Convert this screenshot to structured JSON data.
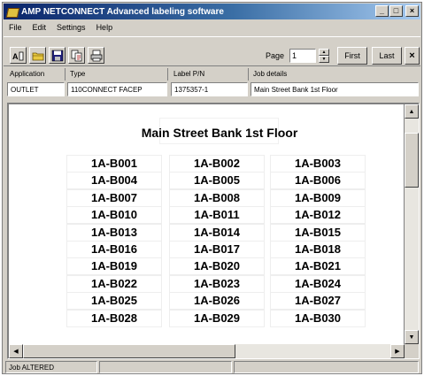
{
  "window": {
    "title": "AMP NETCONNECT Advanced labeling software",
    "minimize": "_",
    "maximize": "□",
    "close": "×"
  },
  "menu": [
    "File",
    "Edit",
    "Settings",
    "Help"
  ],
  "toolbar": {
    "page_label": "Page",
    "page_value": "1",
    "first_label": "First",
    "last_label": "Last",
    "close_label": "×",
    "tools": [
      "new-label-icon",
      "open-folder-icon",
      "save-icon",
      "copy-icon",
      "print-icon"
    ]
  },
  "header": {
    "columns": [
      "Application",
      "Type",
      "Label P/N",
      "Job details"
    ],
    "values": [
      "OUTLET",
      "110CONNECT FACEP",
      "1375357-1",
      "Main Street Bank   1st Floor"
    ]
  },
  "document": {
    "title": "Main Street Bank   1st Floor",
    "labels": [
      [
        "1A-B001",
        "1A-B002",
        "1A-B003"
      ],
      [
        "1A-B004",
        "1A-B005",
        "1A-B006"
      ],
      [
        "1A-B007",
        "1A-B008",
        "1A-B009"
      ],
      [
        "1A-B010",
        "1A-B011",
        "1A-B012"
      ],
      [
        "1A-B013",
        "1A-B014",
        "1A-B015"
      ],
      [
        "1A-B016",
        "1A-B017",
        "1A-B018"
      ],
      [
        "1A-B019",
        "1A-B020",
        "1A-B021"
      ],
      [
        "1A-B022",
        "1A-B023",
        "1A-B024"
      ],
      [
        "1A-B025",
        "1A-B026",
        "1A-B027"
      ],
      [
        "1A-B028",
        "1A-B029",
        "1A-B030"
      ]
    ]
  },
  "status": {
    "text": "Job ALTERED"
  },
  "colors": {
    "titlebar_start": "#0a246a",
    "titlebar_end": "#a6caf0",
    "chrome": "#d4d0c8"
  }
}
